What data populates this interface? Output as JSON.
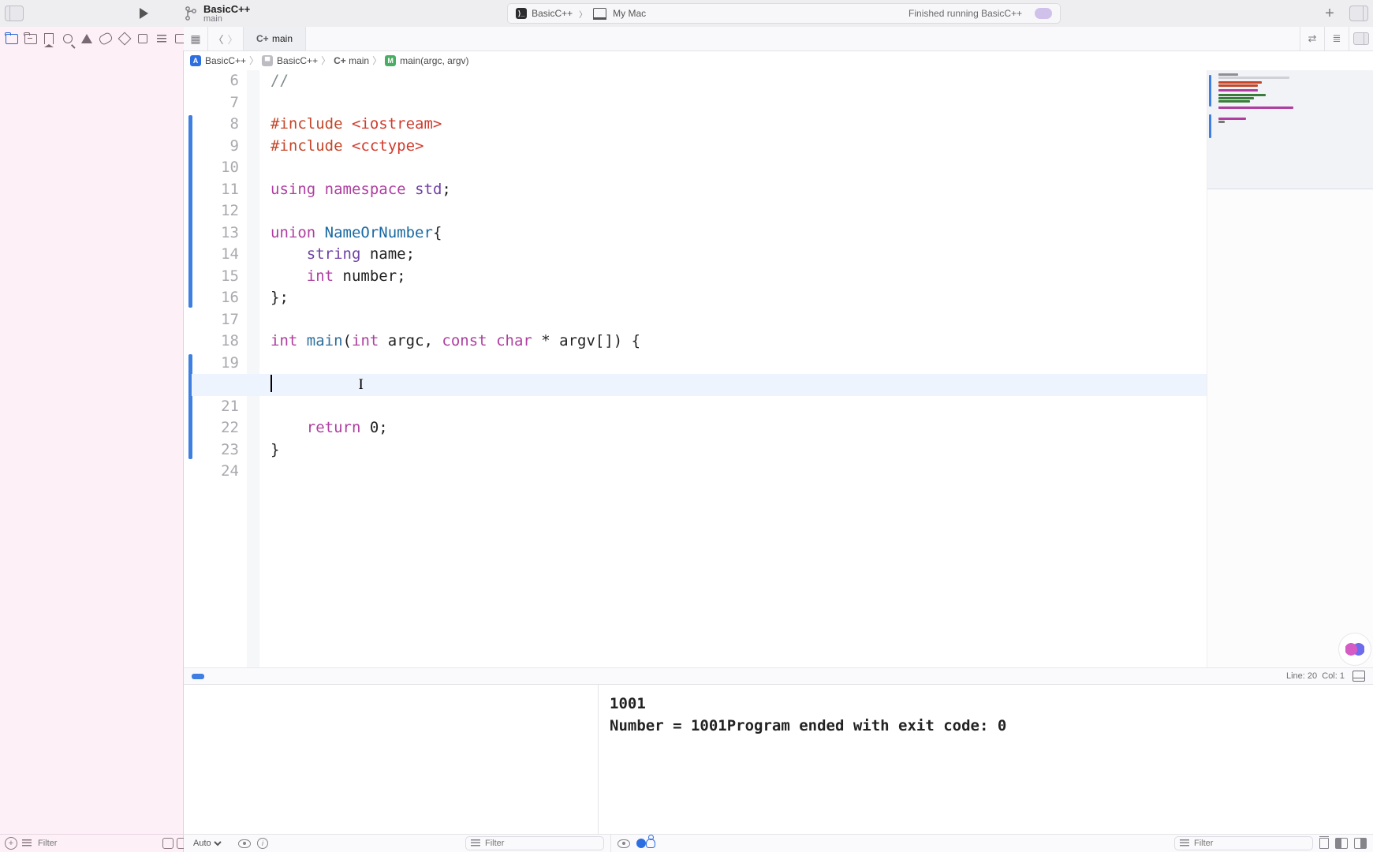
{
  "toolbar": {
    "project_name": "BasicC++",
    "branch": "main",
    "scheme_name": "BasicC++",
    "destination": "My Mac",
    "status": "Finished running BasicC++"
  },
  "tab": {
    "file_label": "main",
    "file_kind": "C+"
  },
  "jumpbar": {
    "project": "BasicC++",
    "group": "BasicC++",
    "file": "main",
    "file_kind": "C+",
    "symbol": "main(argc, argv)"
  },
  "code": {
    "line_start": 6,
    "lines": [
      {
        "tokens": [
          {
            "t": "//",
            "c": "c-cmt"
          }
        ]
      },
      {
        "tokens": []
      },
      {
        "tokens": [
          {
            "t": "#include ",
            "c": "c-prep"
          },
          {
            "t": "<iostream>",
            "c": "c-str"
          }
        ]
      },
      {
        "tokens": [
          {
            "t": "#include ",
            "c": "c-prep"
          },
          {
            "t": "<cctype>",
            "c": "c-str"
          }
        ]
      },
      {
        "tokens": []
      },
      {
        "tokens": [
          {
            "t": "using",
            "c": "c-kw"
          },
          {
            "t": " ",
            "c": "c-plain"
          },
          {
            "t": "namespace",
            "c": "c-kw"
          },
          {
            "t": " ",
            "c": "c-plain"
          },
          {
            "t": "std",
            "c": "c-type"
          },
          {
            "t": ";",
            "c": "c-plain"
          }
        ]
      },
      {
        "tokens": []
      },
      {
        "tokens": [
          {
            "t": "union",
            "c": "c-kw"
          },
          {
            "t": " ",
            "c": "c-plain"
          },
          {
            "t": "NameOrNumber",
            "c": "c-ident2"
          },
          {
            "t": "{",
            "c": "c-plain"
          }
        ]
      },
      {
        "tokens": [
          {
            "t": "    ",
            "c": "c-plain"
          },
          {
            "t": "string",
            "c": "c-type"
          },
          {
            "t": " name;",
            "c": "c-plain"
          }
        ]
      },
      {
        "tokens": [
          {
            "t": "    ",
            "c": "c-plain"
          },
          {
            "t": "int",
            "c": "c-kw"
          },
          {
            "t": " number;",
            "c": "c-plain"
          }
        ]
      },
      {
        "tokens": [
          {
            "t": "};",
            "c": "c-plain"
          }
        ]
      },
      {
        "tokens": []
      },
      {
        "tokens": [
          {
            "t": "int",
            "c": "c-kw"
          },
          {
            "t": " ",
            "c": "c-plain"
          },
          {
            "t": "main",
            "c": "c-ident"
          },
          {
            "t": "(",
            "c": "c-plain"
          },
          {
            "t": "int",
            "c": "c-kw"
          },
          {
            "t": " argc, ",
            "c": "c-plain"
          },
          {
            "t": "const",
            "c": "c-kw"
          },
          {
            "t": " ",
            "c": "c-plain"
          },
          {
            "t": "char",
            "c": "c-kw"
          },
          {
            "t": " * argv[]) {",
            "c": "c-plain"
          }
        ]
      },
      {
        "tokens": []
      },
      {
        "tokens": [],
        "highlight": true,
        "cursor": true,
        "cursor_col_mark": true
      },
      {
        "tokens": []
      },
      {
        "tokens": [
          {
            "t": "    ",
            "c": "c-plain"
          },
          {
            "t": "return",
            "c": "c-kw"
          },
          {
            "t": " 0;",
            "c": "c-plain"
          }
        ]
      },
      {
        "tokens": [
          {
            "t": "}",
            "c": "c-plain"
          }
        ]
      },
      {
        "tokens": []
      }
    ],
    "change_ranges": [
      [
        8,
        16
      ],
      [
        19,
        23
      ]
    ]
  },
  "editor_status": {
    "line_label": "Line:",
    "line": 20,
    "col_label": "Col:",
    "col": 1
  },
  "console": {
    "line1": "1001",
    "line2": "Number = 1001Program ended with exit code: 0"
  },
  "debug_footer": {
    "auto_label": "Auto",
    "filter_placeholder_left": "Filter",
    "filter_placeholder_right": "Filter"
  },
  "nav_footer": {
    "filter_placeholder": "Filter"
  }
}
